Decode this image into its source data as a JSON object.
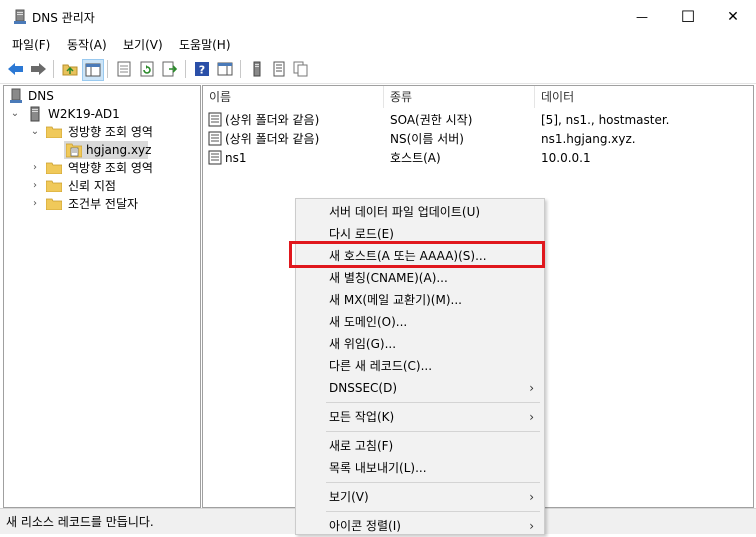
{
  "window": {
    "title": "DNS 관리자",
    "minimize": "—",
    "maximize": "☐",
    "close": "✕"
  },
  "menubar": {
    "items": [
      "파일(F)",
      "동작(A)",
      "보기(V)",
      "도움말(H)"
    ]
  },
  "toolbar": {
    "icons": [
      "back-icon",
      "forward-icon",
      "up-folder-icon",
      "show-tree-icon",
      "properties-icon",
      "refresh-icon",
      "export-icon",
      "help-icon",
      "show-pane-icon",
      "server-icon",
      "list-icon",
      "copy-icon"
    ]
  },
  "tree": {
    "items": [
      {
        "label": "DNS",
        "icon": "dns-icon"
      },
      {
        "label": "W2K19-AD1",
        "icon": "server-icon"
      },
      {
        "label": "정방향 조회 영역",
        "icon": "folder-icon"
      },
      {
        "label": "hgjang.xyz",
        "icon": "zone-icon"
      },
      {
        "label": "역방향 조회 영역",
        "icon": "folder-icon"
      },
      {
        "label": "신뢰 지점",
        "icon": "folder-icon"
      },
      {
        "label": "조건부 전달자",
        "icon": "folder-icon"
      }
    ]
  },
  "list": {
    "columns": [
      "이름",
      "종류",
      "데이터"
    ],
    "rows": [
      {
        "name": "(상위 폴더와 같음)",
        "type": "SOA(권한 시작)",
        "data": "[5], ns1., hostmaster."
      },
      {
        "name": "(상위 폴더와 같음)",
        "type": "NS(이름 서버)",
        "data": "ns1.hgjang.xyz."
      },
      {
        "name": "ns1",
        "type": "호스트(A)",
        "data": "10.0.0.1"
      }
    ]
  },
  "context_menu": {
    "items": [
      {
        "label": "서버 데이터 파일 업데이트(U)"
      },
      {
        "label": "다시 로드(E)"
      },
      {
        "label": "새 호스트(A 또는 AAAA)(S)...",
        "highlighted": true
      },
      {
        "label": "새 별칭(CNAME)(A)..."
      },
      {
        "label": "새 MX(메일 교환기)(M)..."
      },
      {
        "label": "새 도메인(O)..."
      },
      {
        "label": "새 위임(G)..."
      },
      {
        "label": "다른 새 레코드(C)..."
      },
      {
        "label": "DNSSEC(D)",
        "submenu": "›"
      },
      {
        "label": "모든 작업(K)",
        "submenu": "›"
      },
      {
        "label": "새로 고침(F)"
      },
      {
        "label": "목록 내보내기(L)..."
      },
      {
        "label": "보기(V)",
        "submenu": "›"
      },
      {
        "label": "아이콘 정렬(I)",
        "submenu": "›"
      }
    ],
    "highlight_color": "#e0171d"
  },
  "status": {
    "text": "새 리소스 레코드를 만듭니다."
  }
}
